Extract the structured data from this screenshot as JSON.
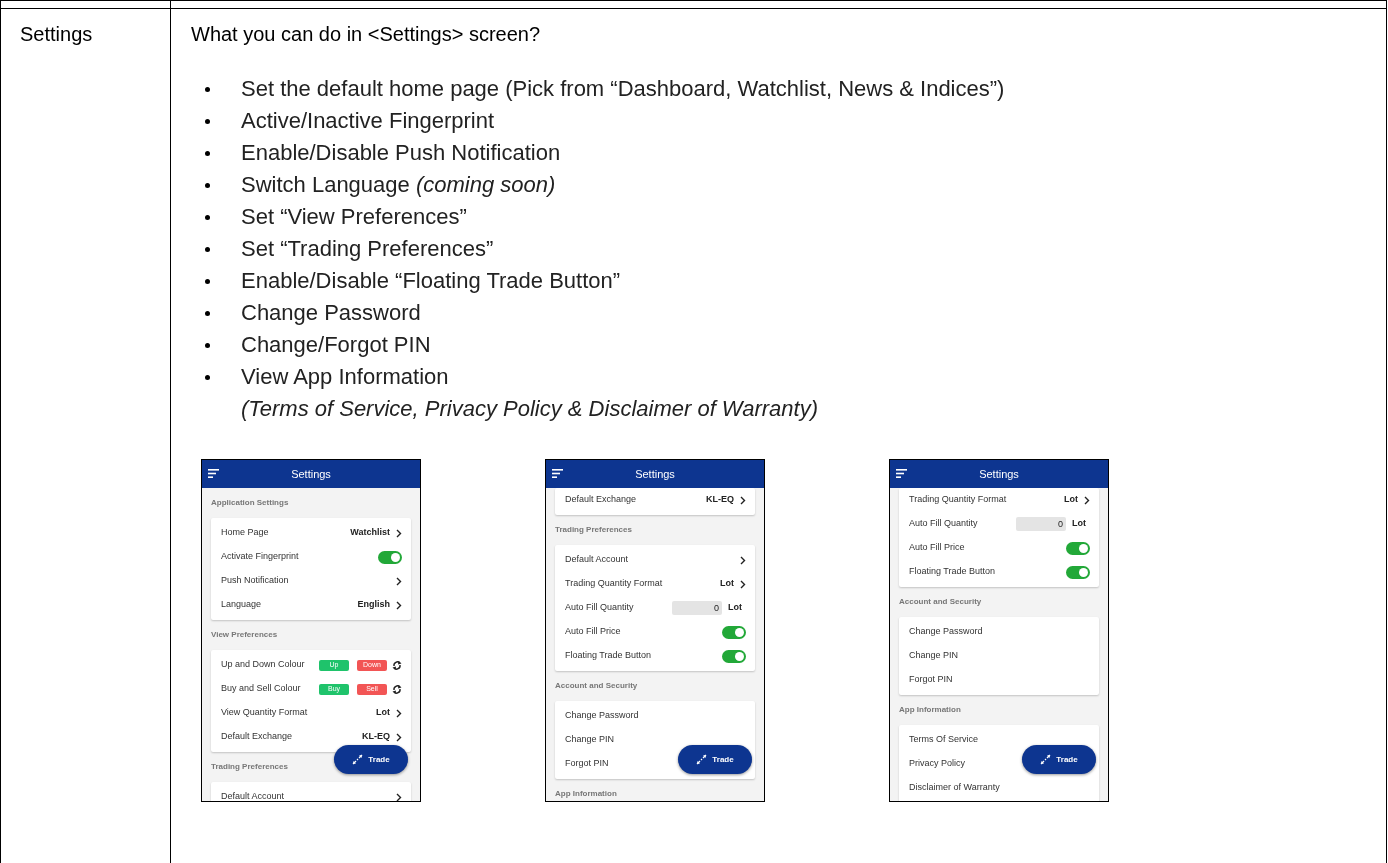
{
  "row_label": "Settings",
  "heading": "What you can do in <Settings> screen?",
  "bullets": [
    {
      "text": "Set the default home page (Pick from “Dashboard, Watchlist, News & Indices”)"
    },
    {
      "text": "Active/Inactive Fingerprint"
    },
    {
      "text": "Enable/Disable Push Notification"
    },
    {
      "text": "Switch Language *(coming soon)*"
    },
    {
      "text": "Set “View Preferences”"
    },
    {
      "text": "Set “Trading Preferences”"
    },
    {
      "text": "Enable/Disable “Floating Trade Button”"
    },
    {
      "text": "Change Password"
    },
    {
      "text": "Change/Forgot PIN"
    },
    {
      "text": "View App Information",
      "note": "(Terms of Service, Privacy Policy & Disclaimer of Warranty)"
    }
  ],
  "phones": [
    {
      "title": "Settings",
      "trade_button": "Trade",
      "blocks": [
        {
          "kind": "section",
          "label": "Application Settings"
        },
        {
          "kind": "card",
          "rows": [
            {
              "kind": "link",
              "label": "Home Page",
              "value": "Watchlist"
            },
            {
              "kind": "toggle",
              "label": "Activate Fingerprint",
              "on": true
            },
            {
              "kind": "link",
              "label": "Push Notification"
            },
            {
              "kind": "link",
              "label": "Language",
              "value": "English"
            }
          ]
        },
        {
          "kind": "section",
          "label": "View Preferences"
        },
        {
          "kind": "card",
          "rows": [
            {
              "kind": "colour",
              "label": "Up and Down Colour",
              "tags": [
                {
                  "label": "Up",
                  "color": "#1fc36b"
                },
                {
                  "label": "Down",
                  "color": "#f25555"
                }
              ]
            },
            {
              "kind": "colour",
              "label": "Buy and Sell Colour",
              "tags": [
                {
                  "label": "Buy",
                  "color": "#1fc36b"
                },
                {
                  "label": "Sell",
                  "color": "#f25555"
                }
              ]
            },
            {
              "kind": "link",
              "label": "View Quantity Format",
              "value": "Lot"
            },
            {
              "kind": "link",
              "label": "Default Exchange",
              "value": "KL-EQ"
            }
          ]
        },
        {
          "kind": "section",
          "label": "Trading Preferences"
        },
        {
          "kind": "card",
          "rows": [
            {
              "kind": "link",
              "label": "Default Account"
            }
          ]
        }
      ]
    },
    {
      "title": "Settings",
      "trade_button": "Trade",
      "blocks": [
        {
          "kind": "card",
          "rows": [
            {
              "kind": "link",
              "label": "Default Exchange",
              "value": "KL-EQ"
            }
          ]
        },
        {
          "kind": "section",
          "label": "Trading Preferences"
        },
        {
          "kind": "card",
          "rows": [
            {
              "kind": "link",
              "label": "Default Account"
            },
            {
              "kind": "link",
              "label": "Trading Quantity Format",
              "value": "Lot"
            },
            {
              "kind": "quantity",
              "label": "Auto Fill Quantity",
              "value": "0",
              "unit": "Lot"
            },
            {
              "kind": "toggle",
              "label": "Auto Fill Price",
              "on": true
            },
            {
              "kind": "toggle",
              "label": "Floating Trade Button",
              "on": true
            }
          ]
        },
        {
          "kind": "section",
          "label": "Account and Security"
        },
        {
          "kind": "card",
          "rows": [
            {
              "kind": "plain",
              "label": "Change Password"
            },
            {
              "kind": "plain",
              "label": "Change PIN"
            },
            {
              "kind": "plain",
              "label": "Forgot PIN"
            }
          ]
        },
        {
          "kind": "section",
          "label": "App Information"
        }
      ]
    },
    {
      "title": "Settings",
      "trade_button": "Trade",
      "blocks": [
        {
          "kind": "card",
          "rows": [
            {
              "kind": "link",
              "label": "Trading Quantity Format",
              "value": "Lot"
            },
            {
              "kind": "quantity",
              "label": "Auto Fill Quantity",
              "value": "0",
              "unit": "Lot"
            },
            {
              "kind": "toggle",
              "label": "Auto Fill Price",
              "on": true
            },
            {
              "kind": "toggle",
              "label": "Floating Trade Button",
              "on": true
            }
          ]
        },
        {
          "kind": "section",
          "label": "Account and Security"
        },
        {
          "kind": "card",
          "rows": [
            {
              "kind": "plain",
              "label": "Change Password"
            },
            {
              "kind": "plain",
              "label": "Change PIN"
            },
            {
              "kind": "plain",
              "label": "Forgot PIN"
            }
          ]
        },
        {
          "kind": "section",
          "label": "App Information"
        },
        {
          "kind": "card",
          "rows": [
            {
              "kind": "plain",
              "label": "Terms Of Service"
            },
            {
              "kind": "plain",
              "label": "Privacy Policy"
            },
            {
              "kind": "plain",
              "label": "Disclaimer of Warranty"
            }
          ]
        }
      ]
    }
  ]
}
